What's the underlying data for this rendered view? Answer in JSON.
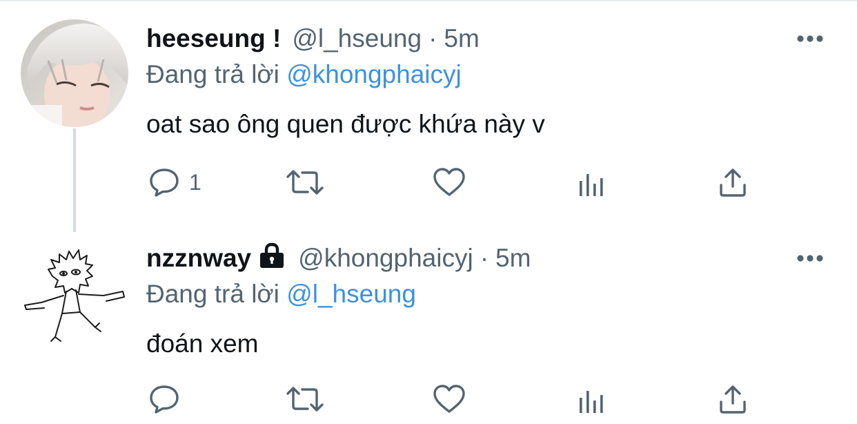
{
  "tweets": [
    {
      "display_name": "heeseung !",
      "handle": "@l_hseung",
      "separator": "·",
      "time": "5m",
      "reply_prefix": "Đang trả lời",
      "reply_to": "@khongphaicyj",
      "text": "oat sao ông quen được khứa này v",
      "reply_count": "1",
      "locked": false
    },
    {
      "display_name": "nzznway",
      "handle": "@khongphaicyj",
      "separator": "·",
      "time": "5m",
      "reply_prefix": "Đang trả lời",
      "reply_to": "@l_hseung",
      "text": "đoán xem",
      "reply_count": "",
      "locked": true
    }
  ],
  "icons": {
    "more": "more-horizontal-icon",
    "reply": "comment-icon",
    "retweet": "retweet-icon",
    "like": "heart-icon",
    "stats": "analytics-icon",
    "share": "share-icon",
    "lock": "lock-icon"
  },
  "colors": {
    "text": "#0f1419",
    "secondary": "#536471",
    "link": "#3d91e0",
    "thread_line": "#d5dbe0",
    "divider": "#e6ecf0"
  }
}
